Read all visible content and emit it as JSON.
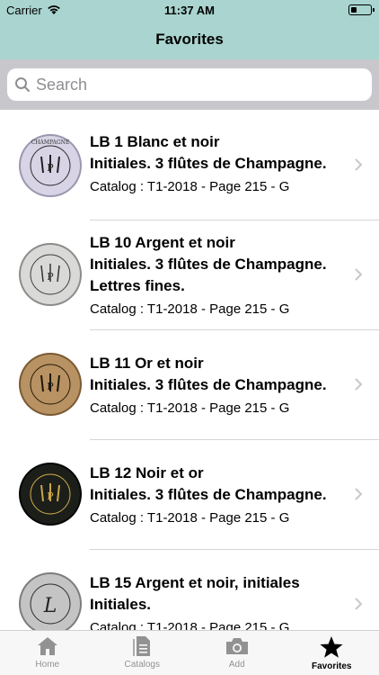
{
  "status_bar": {
    "carrier": "Carrier",
    "time": "11:37 AM"
  },
  "nav": {
    "title": "Favorites"
  },
  "search": {
    "placeholder": "Search"
  },
  "items": [
    {
      "name": "LB 1 Blanc et noir",
      "description": "Initiales. 3 flûtes de Champagne.",
      "catalog": "Catalog : T1-2018 - Page 215 - G",
      "cap_color": "#d8d4e6"
    },
    {
      "name": "LB 10 Argent et noir",
      "description": "Initiales. 3 flûtes de Champagne. Lettres fines.",
      "catalog": "Catalog : T1-2018 - Page 215 - G",
      "cap_color": "#d9d9d7"
    },
    {
      "name": "LB 11 Or et noir",
      "description": "Initiales. 3 flûtes de Champagne.",
      "catalog": "Catalog : T1-2018 - Page 215 - G",
      "cap_color": "#b89262"
    },
    {
      "name": "LB 12 Noir et or",
      "description": "Initiales. 3 flûtes de Champagne.",
      "catalog": "Catalog : T1-2018 - Page 215 - G",
      "cap_color": "#1c1e1a"
    },
    {
      "name": "LB 15 Argent et noir, initiales",
      "description": "Initiales.",
      "catalog": "Catalog : T1-2018 - Page 215 - G",
      "cap_color": "#c4c4c4"
    }
  ],
  "tabs": [
    {
      "label": "Home",
      "icon": "home-icon"
    },
    {
      "label": "Catalogs",
      "icon": "catalog-icon"
    },
    {
      "label": "Add",
      "icon": "camera-icon"
    },
    {
      "label": "Favorites",
      "icon": "star-icon",
      "active": true
    }
  ]
}
